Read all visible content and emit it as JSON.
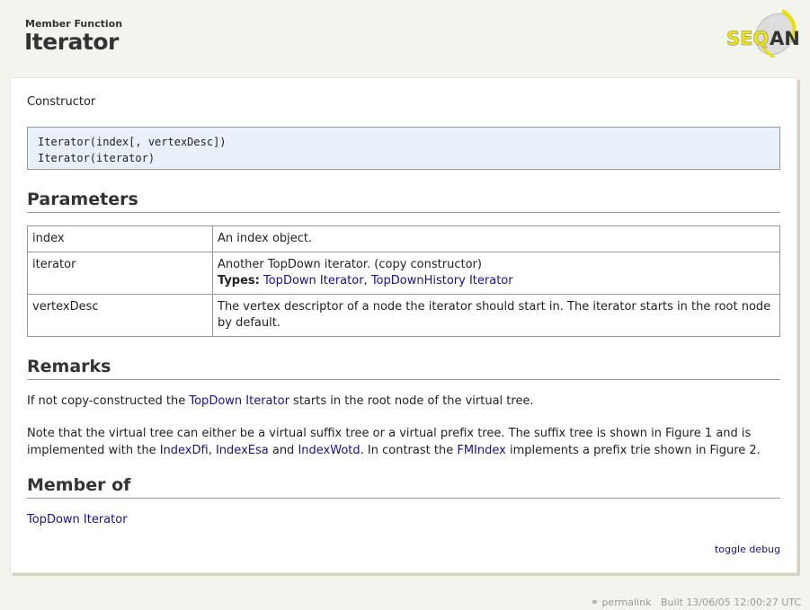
{
  "header": {
    "kind": "Member Function",
    "title": "Iterator",
    "logo_text": "SEQAN"
  },
  "intro": "Constructor",
  "signatures": [
    "Iterator(index[, vertexDesc])",
    "Iterator(iterator)"
  ],
  "parameters": {
    "heading": "Parameters",
    "rows": [
      {
        "name": "index",
        "desc": "An index object."
      },
      {
        "name": "iterator",
        "desc": "Another TopDown iterator. (copy constructor)",
        "types_label": "Types:",
        "types": [
          "TopDown Iterator",
          "TopDownHistory Iterator"
        ]
      },
      {
        "name": "vertexDesc",
        "desc": "The vertex descriptor of a node the iterator should start in. The iterator starts in the root node by default."
      }
    ]
  },
  "remarks": {
    "heading": "Remarks",
    "p1": {
      "pre": "If not copy-constructed the ",
      "link": "TopDown Iterator",
      "post": " starts in the root node of the virtual tree."
    },
    "p2": {
      "pre": "Note that the virtual tree can either be a virtual suffix tree or a virtual prefix tree. The suffix tree is shown in Figure 1 and is implemented with the ",
      "l1": "IndexDfi",
      "s1": ", ",
      "l2": "IndexEsa",
      "s2": " and ",
      "l3": "IndexWotd",
      "s3": ". In contrast the ",
      "l4": "FMIndex",
      "post": " implements a prefix trie shown in Figure 2."
    }
  },
  "member_of": {
    "heading": "Member of",
    "link": "TopDown Iterator"
  },
  "toggle_debug": "toggle debug",
  "footer": {
    "permalink": "permalink",
    "built": "Built 13/06/05 12:00:27 UTC"
  }
}
